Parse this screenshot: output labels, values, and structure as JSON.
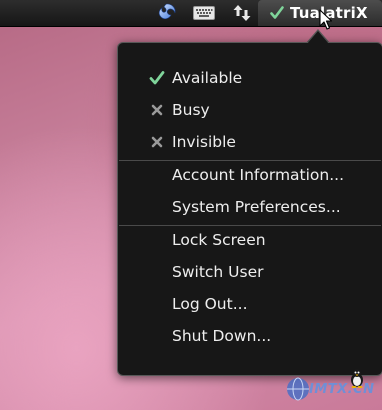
{
  "panel": {
    "user_name": "TualatriX",
    "status_icon": "check-icon",
    "tray_icons": [
      "app-swirl-icon",
      "keyboard-icon",
      "network-arrows-icon"
    ]
  },
  "menu": {
    "status_items": [
      {
        "label": "Available",
        "icon": "check-icon",
        "color": "#7fd49a"
      },
      {
        "label": "Busy",
        "icon": "x-icon",
        "color": "#9a9a9a"
      },
      {
        "label": "Invisible",
        "icon": "x-icon",
        "color": "#9a9a9a"
      }
    ],
    "account_items": [
      {
        "label": "Account Information..."
      },
      {
        "label": "System Preferences..."
      }
    ],
    "session_items": [
      {
        "label": "Lock Screen"
      },
      {
        "label": "Switch User"
      },
      {
        "label": "Log Out..."
      },
      {
        "label": "Shut Down..."
      }
    ]
  },
  "watermark": {
    "text": "IMTX.CN"
  },
  "colors": {
    "accent_check": "#7fd49a",
    "menu_bg": "#171717",
    "panel_bg": "#1e1e1e",
    "menu_text": "#eeeeee"
  }
}
